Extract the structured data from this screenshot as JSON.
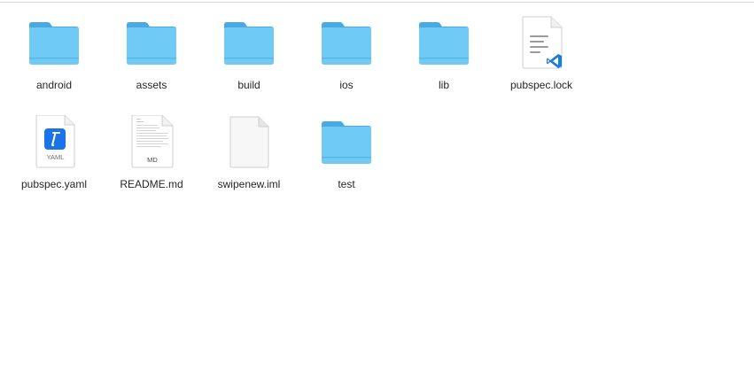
{
  "items": [
    {
      "name": "android",
      "kind": "folder"
    },
    {
      "name": "assets",
      "kind": "folder"
    },
    {
      "name": "build",
      "kind": "folder"
    },
    {
      "name": "ios",
      "kind": "folder"
    },
    {
      "name": "lib",
      "kind": "folder"
    },
    {
      "name": "pubspec.lock",
      "kind": "vscode-document"
    },
    {
      "name": "pubspec.yaml",
      "kind": "yaml-document",
      "badge": "YAML"
    },
    {
      "name": "README.md",
      "kind": "markdown-document",
      "badge": "MD"
    },
    {
      "name": "swipenew.iml",
      "kind": "blank-document"
    },
    {
      "name": "test",
      "kind": "folder"
    }
  ],
  "colors": {
    "folder_front": "#6fcaf5",
    "folder_back": "#4aa9e0",
    "vscode_blue": "#1b7fd6",
    "xcode_blue": "#1a74e8"
  }
}
